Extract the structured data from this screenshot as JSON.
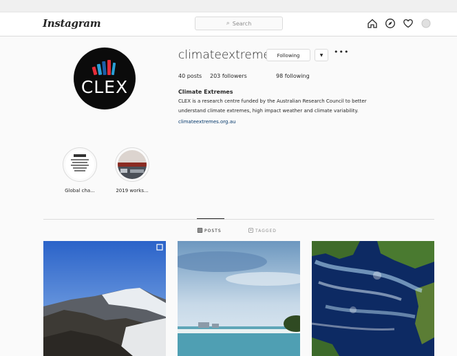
{
  "header": {
    "logo_text": "Instagram",
    "search_placeholder": "Search",
    "icons": [
      "home-icon",
      "explore-icon",
      "heart-icon",
      "profile-icon"
    ]
  },
  "profile": {
    "username": "climateextremes",
    "follow_button_label": "Following",
    "more_label": "•••",
    "posts_count": "40 posts",
    "followers_count": "203 followers",
    "following_count": "98 following",
    "full_name": "Climate Extremes",
    "bio_lines": [
      "CLEX is a research centre funded by the Australian Research Council to better",
      "understand climate extremes, high impact weather and climate variability."
    ],
    "website": "climateextremes.org.au",
    "avatar_text": "CLEX"
  },
  "highlights": [
    {
      "label": "Global cha..."
    },
    {
      "label": "2019 works..."
    }
  ],
  "tabs": [
    {
      "label": "POSTS",
      "active": true
    },
    {
      "label": "TAGGED",
      "active": false
    }
  ],
  "colors": {
    "accent_link": "#003569",
    "border": "#dbdbdb",
    "background": "#fafafa"
  }
}
